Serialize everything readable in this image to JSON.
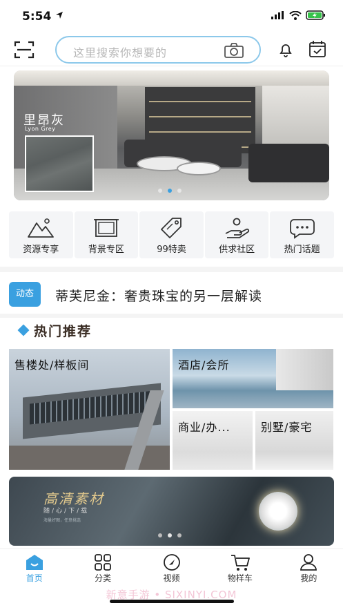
{
  "status_bar": {
    "time": "5:54"
  },
  "header": {
    "search_placeholder": "这里搜索你想要的"
  },
  "banner": {
    "title": "里昂灰",
    "subtitle": "Lyon Grey",
    "dot_count": 3,
    "active_dot": 1
  },
  "quick_nav": [
    {
      "label": "资源专享",
      "icon": "mountain-icon"
    },
    {
      "label": "背景专区",
      "icon": "frame-icon"
    },
    {
      "label": "99特卖",
      "icon": "tag-icon"
    },
    {
      "label": "供求社区",
      "icon": "hand-people-icon"
    },
    {
      "label": "热门话题",
      "icon": "chat-bubble-icon"
    }
  ],
  "news": {
    "tag": "动态",
    "text": "蒂芙尼金：奢贵珠宝的另一层解读"
  },
  "section": {
    "title": "热门推荐"
  },
  "recommend": [
    {
      "label": "售楼处/样板间"
    },
    {
      "label": "酒店/会所"
    },
    {
      "label": "商业/办..."
    },
    {
      "label": "别墅/豪宅"
    }
  ],
  "promo": {
    "title": "高清素材",
    "subtitle": "随/心/下/载",
    "small": "海量好图，任意挑选",
    "dot_count": 3
  },
  "tabbar": [
    {
      "label": "首页",
      "icon": "home-icon",
      "active": true
    },
    {
      "label": "分类",
      "icon": "grid-icon",
      "active": false
    },
    {
      "label": "视频",
      "icon": "play-disc-icon",
      "active": false
    },
    {
      "label": "物样车",
      "icon": "cart-icon",
      "active": false
    },
    {
      "label": "我的",
      "icon": "user-icon",
      "active": false
    }
  ],
  "watermark": "新意手游 • SIXINYI.COM",
  "colors": {
    "accent": "#3aa0e0",
    "section_title": "#3a2d24",
    "promo_gold": "#e2c98d"
  }
}
